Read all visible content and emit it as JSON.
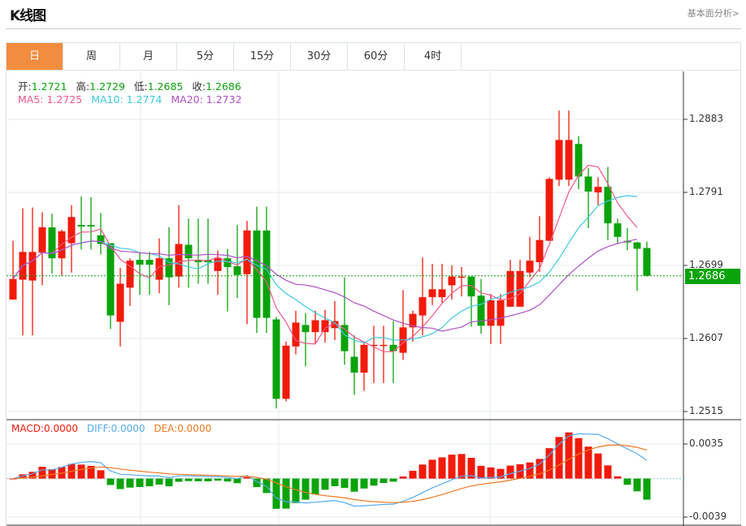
{
  "header": {
    "title": "K线图",
    "link": "基本面分析>"
  },
  "tabs": [
    {
      "label": "日",
      "active": true
    },
    {
      "label": "周"
    },
    {
      "label": "月"
    },
    {
      "label": "5分"
    },
    {
      "label": "15分"
    },
    {
      "label": "30分"
    },
    {
      "label": "60分"
    },
    {
      "label": "4时"
    }
  ],
  "info": {
    "open_label": "开:",
    "open": "1.2721",
    "high_label": "高:",
    "high": "1.2729",
    "low_label": "低:",
    "low": "1.2685",
    "close_label": "收:",
    "close": "1.2686",
    "ma5": "MA5: 1.2725",
    "ma10": "MA10: 1.2774",
    "ma20": "MA20: 1.2732"
  },
  "macd_legend": {
    "macd": "MACD:0.0000",
    "diff": "DIFF:0.0000",
    "dea": "DEA:0.0000"
  },
  "colors": {
    "up": "#f21a0a",
    "down": "#0aa30a",
    "ma5": "#f0588a",
    "ma10": "#3fc8e0",
    "ma20": "#b050c8",
    "diff": "#55aaee",
    "dea": "#f07820",
    "tab_active": "#f28c3f"
  },
  "chart_data": {
    "type": "candlestick",
    "price_axis": {
      "ticks": [
        "1.2883",
        "1.2791",
        "1.2699",
        "1.2607",
        "1.2515"
      ],
      "range": [
        1.2515,
        1.2883
      ]
    },
    "current_price": "1.2686",
    "macd_axis": {
      "ticks": [
        "0.0035",
        "-0.0039"
      ],
      "range": [
        -0.0039,
        0.0035
      ]
    },
    "ma_periods": [
      5,
      10,
      20
    ],
    "ohlc": [
      [
        1.2656,
        1.273,
        1.2656,
        1.2682
      ],
      [
        1.2681,
        1.2771,
        1.2611,
        1.2716
      ],
      [
        1.268,
        1.2772,
        1.2611,
        1.2716
      ],
      [
        1.2715,
        1.2766,
        1.2674,
        1.2747
      ],
      [
        1.2747,
        1.2764,
        1.2689,
        1.2708
      ],
      [
        1.2708,
        1.2744,
        1.2686,
        1.2742
      ],
      [
        1.2727,
        1.2775,
        1.269,
        1.276
      ],
      [
        1.275,
        1.2786,
        1.2719,
        1.2748
      ],
      [
        1.275,
        1.2785,
        1.2719,
        1.2748
      ],
      [
        1.2737,
        1.2765,
        1.2713,
        1.2726
      ],
      [
        1.2727,
        1.2727,
        1.2619,
        1.2636
      ],
      [
        1.2628,
        1.2696,
        1.2597,
        1.2676
      ],
      [
        1.2671,
        1.2708,
        1.2648,
        1.2705
      ],
      [
        1.2706,
        1.2716,
        1.2662,
        1.27
      ],
      [
        1.2706,
        1.2716,
        1.2662,
        1.27
      ],
      [
        1.2681,
        1.2733,
        1.2664,
        1.2708
      ],
      [
        1.2708,
        1.2747,
        1.2649,
        1.2684
      ],
      [
        1.2685,
        1.2775,
        1.2671,
        1.2726
      ],
      [
        1.2725,
        1.2758,
        1.2671,
        1.2708
      ],
      [
        1.2706,
        1.2758,
        1.2676,
        1.2703
      ],
      [
        1.2706,
        1.2758,
        1.2676,
        1.2703
      ],
      [
        1.2692,
        1.2718,
        1.2662,
        1.2708
      ],
      [
        1.2708,
        1.272,
        1.2641,
        1.2697
      ],
      [
        1.2698,
        1.275,
        1.2658,
        1.2687
      ],
      [
        1.2688,
        1.2755,
        1.2625,
        1.2743
      ],
      [
        1.2743,
        1.2773,
        1.2614,
        1.2633
      ],
      [
        1.2743,
        1.2773,
        1.2614,
        1.2633
      ],
      [
        1.2631,
        1.2634,
        1.2519,
        1.2531
      ],
      [
        1.2531,
        1.2603,
        1.2528,
        1.2598
      ],
      [
        1.2597,
        1.2642,
        1.2587,
        1.2627
      ],
      [
        1.2624,
        1.2639,
        1.2572,
        1.2615
      ],
      [
        1.2615,
        1.2642,
        1.2601,
        1.263
      ],
      [
        1.2615,
        1.2643,
        1.2602,
        1.263
      ],
      [
        1.262,
        1.2654,
        1.2605,
        1.2629
      ],
      [
        1.2624,
        1.2684,
        1.2574,
        1.2591
      ],
      [
        1.2584,
        1.2611,
        1.2536,
        1.2564
      ],
      [
        1.2564,
        1.2603,
        1.2541,
        1.2599
      ],
      [
        1.2598,
        1.2623,
        1.2551,
        1.2599
      ],
      [
        1.2598,
        1.2623,
        1.2551,
        1.2599
      ],
      [
        1.2599,
        1.2629,
        1.2551,
        1.2591
      ],
      [
        1.2589,
        1.2668,
        1.258,
        1.2621
      ],
      [
        1.2621,
        1.2642,
        1.2603,
        1.2638
      ],
      [
        1.2636,
        1.2709,
        1.2611,
        1.2659
      ],
      [
        1.2659,
        1.2701,
        1.2649,
        1.2669
      ],
      [
        1.2659,
        1.2701,
        1.2652,
        1.2669
      ],
      [
        1.2674,
        1.2699,
        1.2656,
        1.2685
      ],
      [
        1.2684,
        1.2697,
        1.266,
        1.2685
      ],
      [
        1.2685,
        1.2685,
        1.2622,
        1.266
      ],
      [
        1.2661,
        1.2682,
        1.2613,
        1.2623
      ],
      [
        1.2623,
        1.2663,
        1.26,
        1.2655
      ],
      [
        1.2623,
        1.2663,
        1.26,
        1.2655
      ],
      [
        1.2647,
        1.2706,
        1.2647,
        1.2692
      ],
      [
        1.2647,
        1.2706,
        1.2647,
        1.2692
      ],
      [
        1.269,
        1.2735,
        1.2684,
        1.2705
      ],
      [
        1.2703,
        1.2761,
        1.2691,
        1.2731
      ],
      [
        1.273,
        1.281,
        1.273,
        1.2808
      ],
      [
        1.2807,
        1.2894,
        1.2799,
        1.2857
      ],
      [
        1.2807,
        1.2894,
        1.2799,
        1.2857
      ],
      [
        1.2852,
        1.2862,
        1.2795,
        1.2811
      ],
      [
        1.2811,
        1.2822,
        1.2746,
        1.2792
      ],
      [
        1.2791,
        1.281,
        1.2775,
        1.2798
      ],
      [
        1.2798,
        1.2823,
        1.2731,
        1.2752
      ],
      [
        1.2752,
        1.2758,
        1.2726,
        1.2735
      ],
      [
        1.273,
        1.2746,
        1.2718,
        1.2728
      ],
      [
        1.2728,
        1.2729,
        1.2667,
        1.272
      ],
      [
        1.2721,
        1.2729,
        1.2685,
        1.2686
      ]
    ]
  }
}
